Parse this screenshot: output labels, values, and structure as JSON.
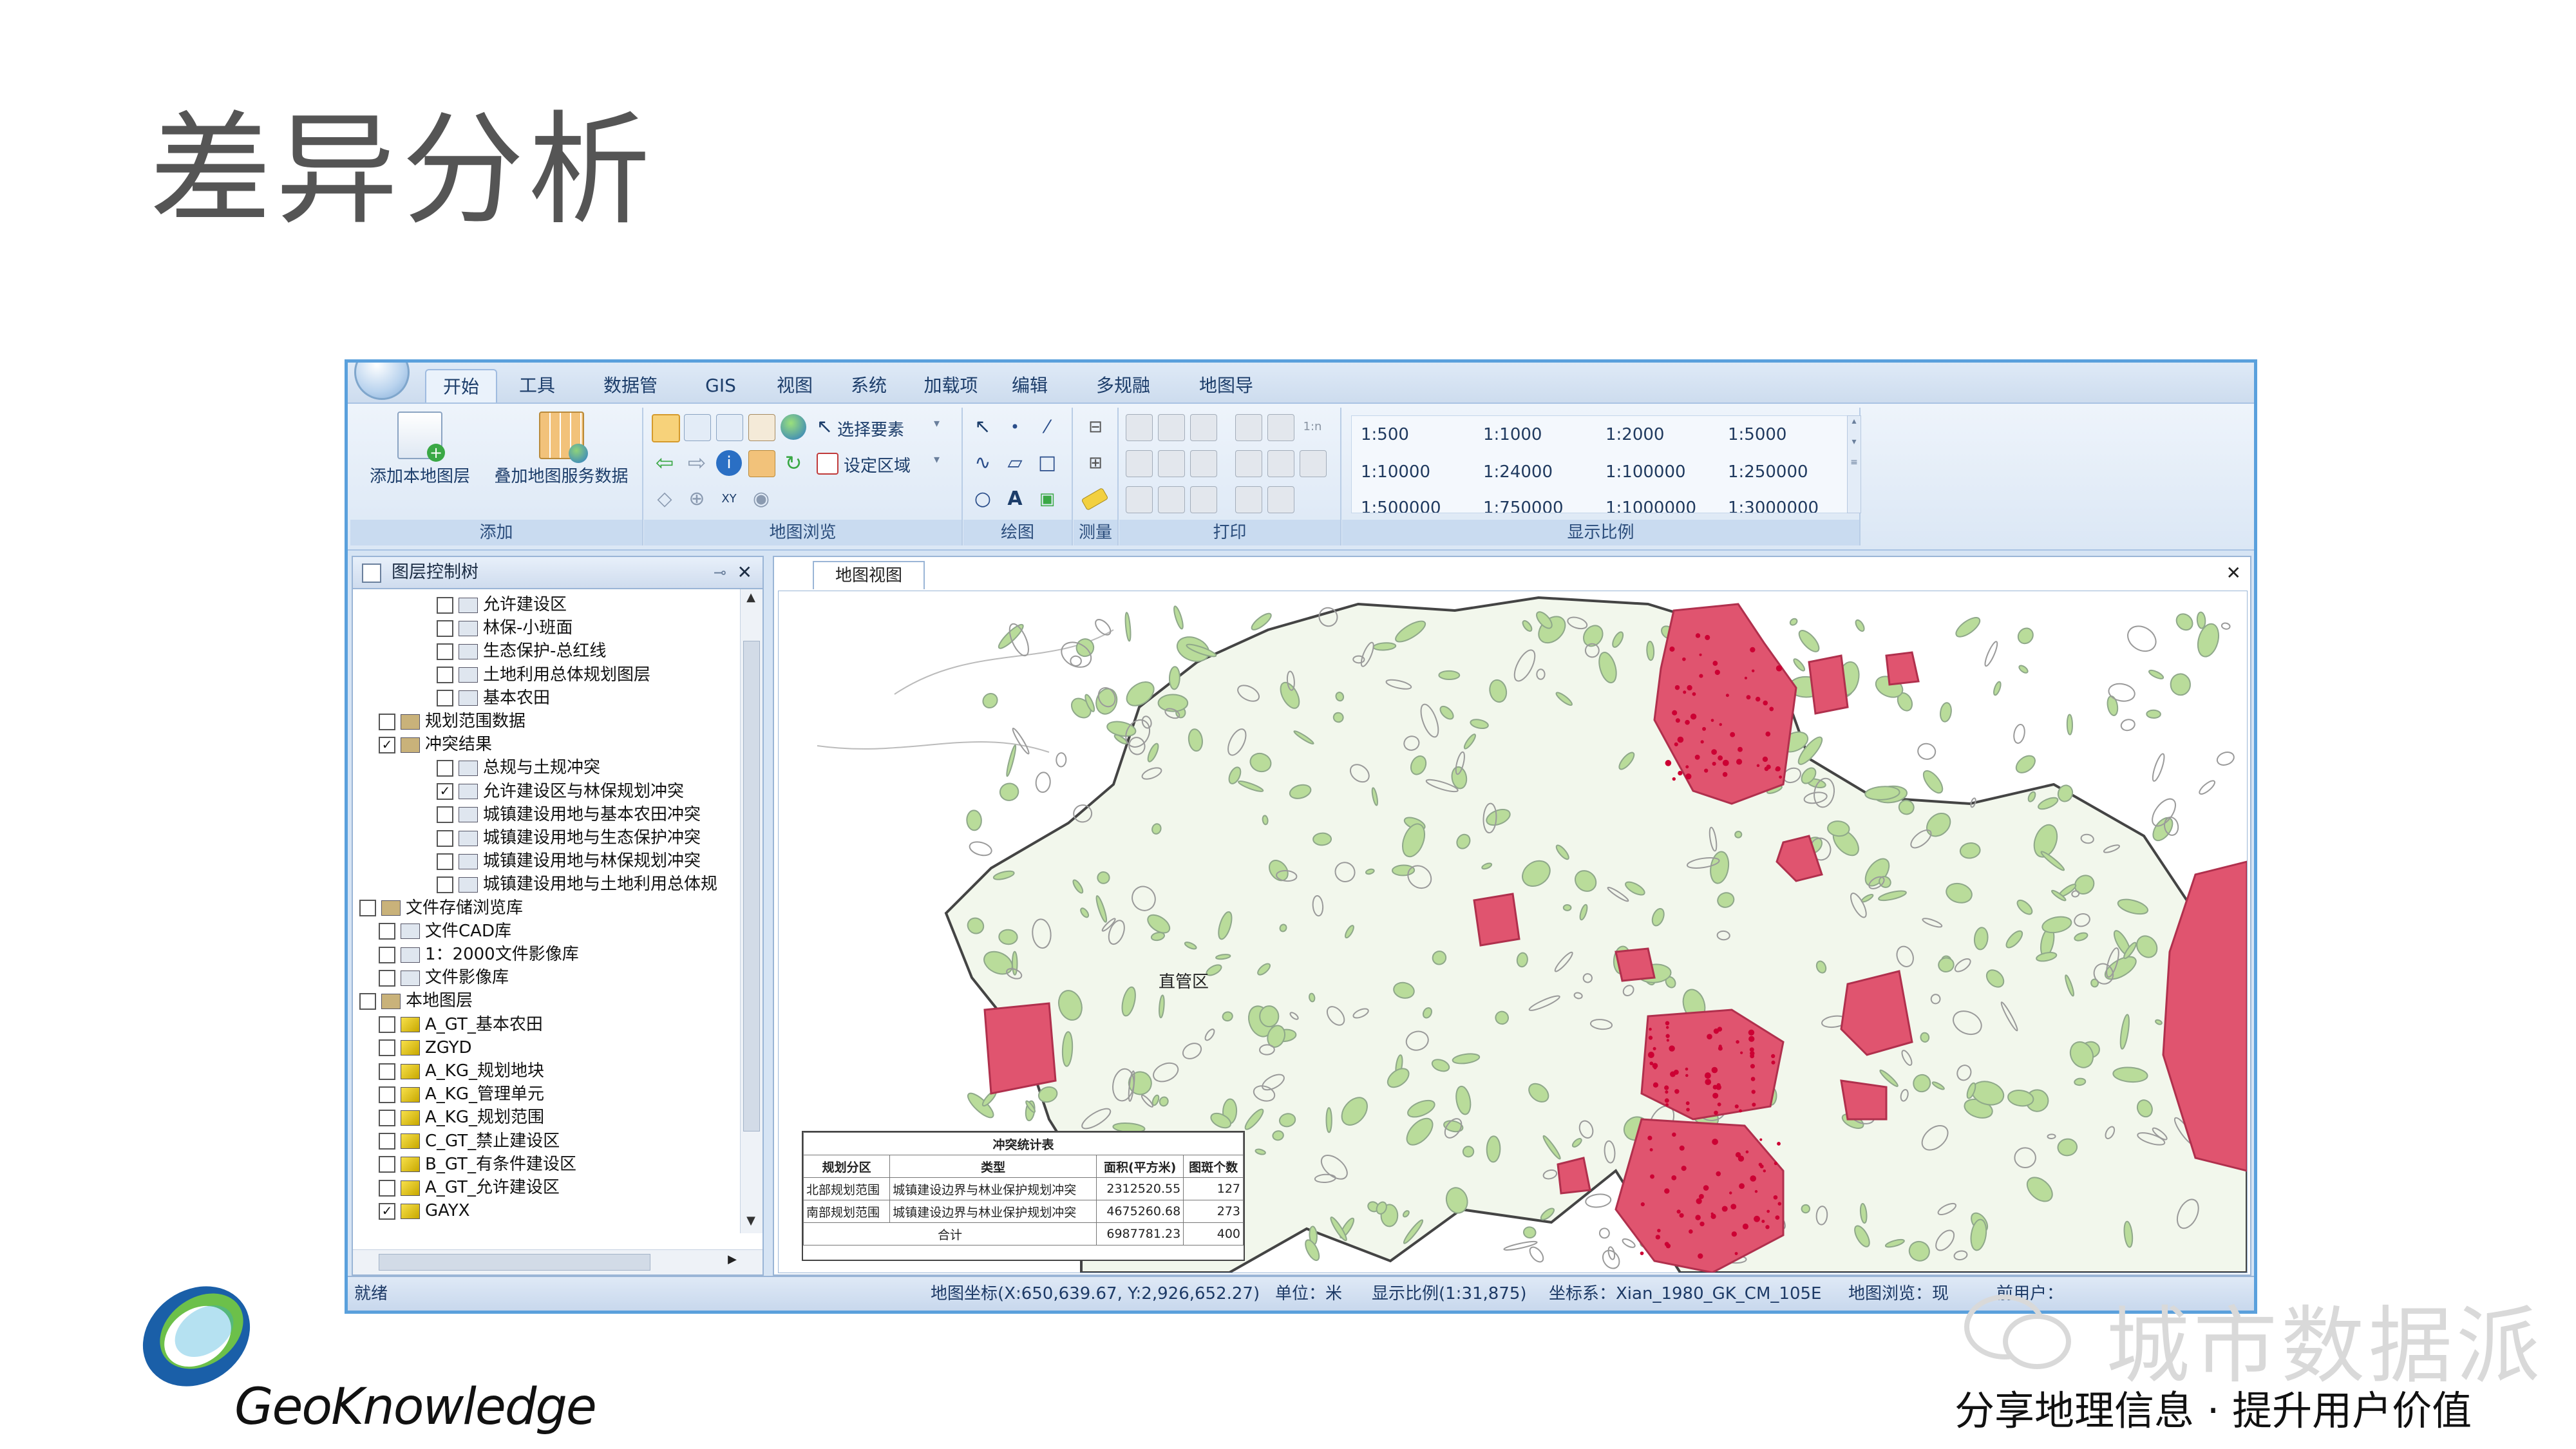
{
  "slide": {
    "title": "差异分析"
  },
  "ribbon": {
    "tabs": [
      "开始",
      "工具",
      "数据管理",
      "GIS",
      "视图",
      "系统",
      "加载项",
      "编辑",
      "多规融合",
      "地图导航"
    ],
    "groups": {
      "add": {
        "label": "添加",
        "add_local_layer": "添加本地图层",
        "overlay_service": "叠加地图服务数据"
      },
      "browse": {
        "label": "地图浏览",
        "select_features": "选择要素",
        "set_region": "设定区域"
      },
      "draw": {
        "label": "绘图"
      },
      "measure": {
        "label": "测量"
      },
      "print": {
        "label": "打印"
      },
      "scale": {
        "label": "显示比例",
        "items": [
          "1:500",
          "1:1000",
          "1:2000",
          "1:5000",
          "1:10000",
          "1:24000",
          "1:100000",
          "1:250000",
          "1:500000",
          "1:750000",
          "1:1000000",
          "1:3000000"
        ]
      }
    }
  },
  "layer_panel": {
    "title": "图层控制树",
    "nodes": [
      {
        "label": "允许建设区",
        "checked": false
      },
      {
        "label": "林保-小班面",
        "checked": false
      },
      {
        "label": "生态保护-总红线",
        "checked": false
      },
      {
        "label": "土地利用总体规划图层",
        "checked": false
      },
      {
        "label": "基本农田",
        "checked": false
      },
      {
        "label": "规划范围数据",
        "checked": false
      },
      {
        "label": "冲突结果",
        "checked": true
      },
      {
        "label": "总规与土规冲突",
        "checked": false
      },
      {
        "label": "允许建设区与林保规划冲突",
        "checked": true
      },
      {
        "label": "城镇建设用地与基本农田冲突",
        "checked": false
      },
      {
        "label": "城镇建设用地与生态保护冲突",
        "checked": false
      },
      {
        "label": "城镇建设用地与林保规划冲突",
        "checked": false
      },
      {
        "label": "城镇建设用地与土地利用总体规",
        "checked": false
      },
      {
        "label": "文件存储浏览库",
        "checked": false
      },
      {
        "label": "文件CAD库",
        "checked": false
      },
      {
        "label": "1：2000文件影像库",
        "checked": false
      },
      {
        "label": "文件影像库",
        "checked": false
      },
      {
        "label": "本地图层",
        "checked": false
      },
      {
        "label": "A_GT_基本农田",
        "checked": false
      },
      {
        "label": "ZGYD",
        "checked": false
      },
      {
        "label": "A_KG_规划地块",
        "checked": false
      },
      {
        "label": "A_KG_管理单元",
        "checked": false
      },
      {
        "label": "A_KG_规划范围",
        "checked": false
      },
      {
        "label": "C_GT_禁止建设区",
        "checked": false
      },
      {
        "label": "B_GT_有条件建设区",
        "checked": false
      },
      {
        "label": "A_GT_允许建设区",
        "checked": false
      },
      {
        "label": "GAYX",
        "checked": true
      }
    ]
  },
  "map": {
    "tab_label": "地图视图",
    "place_label": "直管区",
    "stat_table": {
      "title": "冲突统计表",
      "headers": [
        "规划分区",
        "类型",
        "面积(平方米)",
        "图斑个数"
      ],
      "rows": [
        [
          "北部规划范围",
          "城镇建设边界与林业保护规划冲突",
          "2312520.55",
          "127"
        ],
        [
          "南部规划范围",
          "城镇建设边界与林业保护规划冲突",
          "4675260.68",
          "273"
        ],
        [
          "合计",
          "",
          "6987781.23",
          "400"
        ]
      ]
    }
  },
  "statusbar": {
    "ready": "就绪",
    "coords": "地图坐标(X:650,639.67, Y:2,926,652.27)",
    "unit": "单位：米",
    "scale": "显示比例(1:31,875)",
    "crs": "坐标系：Xian_1980_GK_CM_105E",
    "browse": "地图浏览：现",
    "user": "前用户："
  },
  "footer": {
    "logo": "GeoKnowledge",
    "brand": "城市数据派",
    "tagline": "分享地理信息 · 提升用户价值"
  },
  "colors": {
    "conflict": "#e0546f",
    "green": "#b9dc9a",
    "accent": "#5aa0dc"
  }
}
